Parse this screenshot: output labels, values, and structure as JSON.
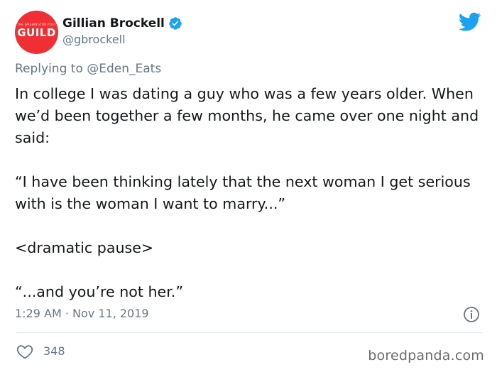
{
  "author": {
    "display_name": "Gillian Brockell",
    "handle": "@gbrockell",
    "avatar_top_text": "THE WASHINGTON POST",
    "avatar_text": "GUILD"
  },
  "reply": {
    "prefix": "Replying to",
    "mention": "@Eden_Eats"
  },
  "tweet": {
    "paragraphs": [
      "In college I was dating a guy who was a few years older. When we’d been together a few months, he came over one night and said:",
      "“I have been thinking lately that the next woman I get serious with is the woman I want to marry...”",
      "<dramatic pause>",
      "“...and you’re not her.”"
    ],
    "time": "1:29 AM · Nov 11, 2019",
    "likes": "348"
  },
  "watermark": "boredpanda.com",
  "colors": {
    "twitter_blue": "#1da1f2",
    "avatar_red": "#ef2f33",
    "secondary_text": "#657786"
  },
  "icons": [
    "verified-badge-icon",
    "twitter-bird-icon",
    "info-icon",
    "heart-icon"
  ]
}
